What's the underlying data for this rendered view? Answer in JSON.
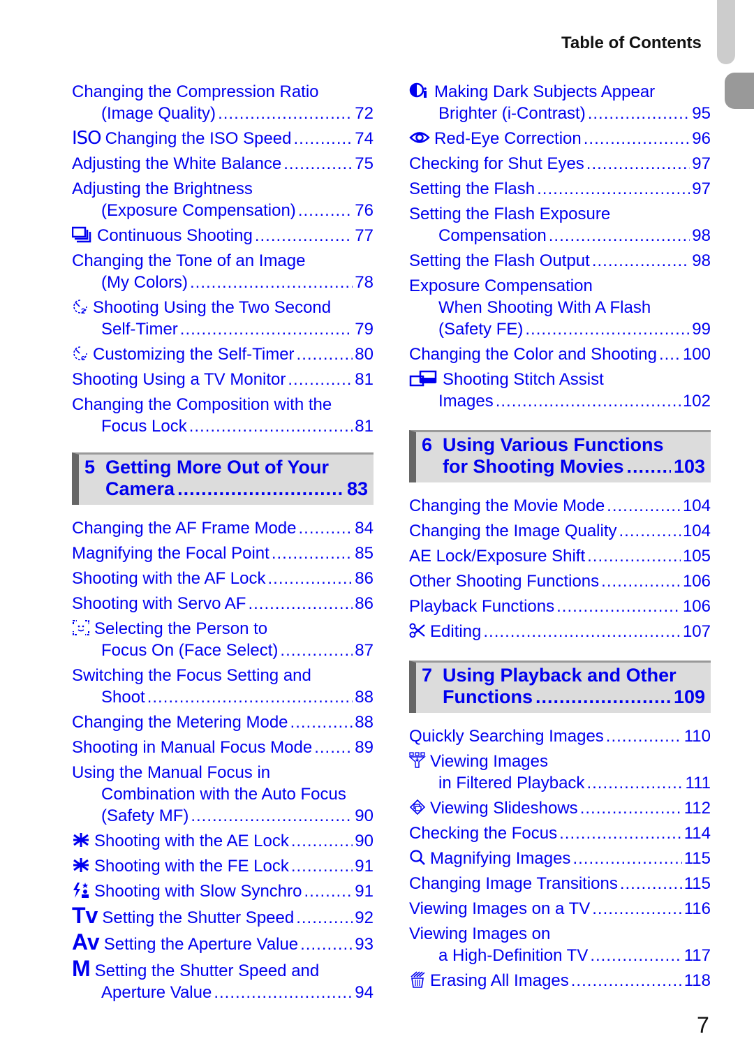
{
  "header": {
    "title": "Table of Contents"
  },
  "page_number": "7",
  "left": {
    "e1": {
      "line1": "Changing the Compression Ratio",
      "line2": "(Image Quality)",
      "page": "72"
    },
    "e2": {
      "icon": "iso-icon",
      "icon_text": "ISO",
      "line1": "Changing the ISO Speed",
      "page": "74"
    },
    "e3": {
      "line1": "Adjusting the White Balance",
      "page": "75"
    },
    "e4": {
      "line1": "Adjusting the Brightness",
      "line2": "(Exposure Compensation)",
      "page": "76"
    },
    "e5": {
      "icon": "continuous-shooting-icon",
      "line1": "Continuous Shooting",
      "page": "77"
    },
    "e6": {
      "line1": "Changing the Tone of an Image",
      "line2": "(My Colors)",
      "page": "78"
    },
    "e7": {
      "icon": "two-second-timer-icon",
      "line1": "Shooting Using the Two Second",
      "line2": "Self-Timer",
      "page": "79"
    },
    "e8": {
      "icon": "custom-timer-icon",
      "line1": "Customizing the Self-Timer",
      "page": "80"
    },
    "e9": {
      "line1": "Shooting Using a TV Monitor",
      "page": "81"
    },
    "e10": {
      "line1": "Changing the Composition with the",
      "line2": "Focus Lock",
      "page": "81"
    },
    "chapter5": {
      "number": "5",
      "line1": "Getting More Out of Your",
      "line2": "Camera",
      "page": "83"
    },
    "e11": {
      "line1": "Changing the AF Frame Mode",
      "page": "84"
    },
    "e12": {
      "line1": "Magnifying the Focal Point",
      "page": "85"
    },
    "e13": {
      "line1": "Shooting with the AF Lock",
      "page": "86"
    },
    "e14": {
      "line1": "Shooting with Servo AF",
      "page": "86"
    },
    "e15": {
      "icon": "face-select-icon",
      "line1": "Selecting the Person to",
      "line2": "Focus On (Face Select)",
      "page": "87"
    },
    "e16": {
      "line1": "Switching the Focus Setting and",
      "line2": "Shoot",
      "page": "88"
    },
    "e17": {
      "line1": "Changing the Metering Mode",
      "page": "88"
    },
    "e18": {
      "line1": "Shooting in Manual Focus Mode",
      "page": "89"
    },
    "e19": {
      "line1": "Using the Manual Focus in",
      "line2": "Combination with the Auto Focus",
      "line3": "(Safety MF)",
      "page": "90"
    },
    "e20": {
      "icon": "ae-lock-icon",
      "line1": "Shooting with the AE Lock",
      "page": "90"
    },
    "e21": {
      "icon": "fe-lock-icon",
      "line1": "Shooting with the FE Lock",
      "page": "91"
    },
    "e22": {
      "icon": "slow-synchro-icon",
      "line1": "Shooting with Slow Synchro",
      "page": "91"
    },
    "e23": {
      "icon": "tv-mode-icon",
      "icon_text": "Tv",
      "line1": "Setting the Shutter Speed",
      "page": "92"
    },
    "e24": {
      "icon": "av-mode-icon",
      "icon_text": "Av",
      "line1": "Setting the Aperture Value",
      "page": "93"
    },
    "e25": {
      "icon": "manual-mode-icon",
      "icon_text": "M",
      "line1": "Setting the Shutter Speed and",
      "line2": "Aperture Value",
      "page": "94"
    }
  },
  "right": {
    "e1": {
      "icon": "i-contrast-icon",
      "line1": "Making Dark Subjects Appear",
      "line2": "Brighter (i-Contrast)",
      "page": "95"
    },
    "e2": {
      "icon": "red-eye-icon",
      "line1": "Red-Eye Correction",
      "page": "96"
    },
    "e3": {
      "line1": "Checking for Shut Eyes",
      "page": "97"
    },
    "e4": {
      "line1": "Setting the Flash",
      "page": "97"
    },
    "e5": {
      "line1": "Setting the Flash Exposure",
      "line2": "Compensation",
      "page": "98"
    },
    "e6": {
      "line1": "Setting the Flash Output",
      "page": "98"
    },
    "e7": {
      "line1": "Exposure Compensation",
      "line2": "When Shooting With A Flash",
      "line3": "(Safety FE)",
      "page": "99"
    },
    "e8": {
      "line1": "Changing the Color and Shooting",
      "page": "100"
    },
    "e9": {
      "icon": "stitch-assist-icon",
      "line1": "Shooting Stitch Assist",
      "line2": "Images",
      "page": "102"
    },
    "chapter6": {
      "number": "6",
      "line1": "Using Various Functions",
      "line2": "for Shooting Movies",
      "page": "103"
    },
    "e10": {
      "line1": "Changing the Movie Mode",
      "page": "104"
    },
    "e11": {
      "line1": "Changing the Image Quality",
      "page": "104"
    },
    "e12": {
      "line1": "AE Lock/Exposure Shift",
      "page": "105"
    },
    "e13": {
      "line1": "Other Shooting Functions",
      "page": "106"
    },
    "e14": {
      "line1": "Playback Functions",
      "page": "106"
    },
    "e15": {
      "icon": "scissors-icon",
      "line1": "Editing",
      "page": "107"
    },
    "chapter7": {
      "number": "7",
      "line1": "Using Playback and Other",
      "line2": "Functions",
      "page": "109"
    },
    "e16": {
      "line1": "Quickly Searching Images",
      "page": "110"
    },
    "e17": {
      "icon": "filtered-playback-icon",
      "line1": "Viewing Images",
      "line2": "in Filtered Playback",
      "page": "111"
    },
    "e18": {
      "icon": "slideshow-icon",
      "line1": "Viewing Slideshows",
      "page": "112"
    },
    "e19": {
      "line1": "Checking the Focus",
      "page": "114"
    },
    "e20": {
      "icon": "magnify-icon",
      "line1": "Magnifying Images",
      "page": "115"
    },
    "e21": {
      "line1": "Changing Image Transitions",
      "page": "115"
    },
    "e22": {
      "line1": "Viewing Images on a TV",
      "page": "116"
    },
    "e23": {
      "line1": "Viewing Images on",
      "line2": "a High-Definition TV",
      "page": "117"
    },
    "e24": {
      "icon": "erase-all-icon",
      "line1": "Erasing All Images",
      "page": "118"
    }
  },
  "colors": {
    "link": "#0000ee",
    "chapter_bg": "#dcdcdc",
    "chapter_bar": "#666666",
    "text": "#111111"
  }
}
